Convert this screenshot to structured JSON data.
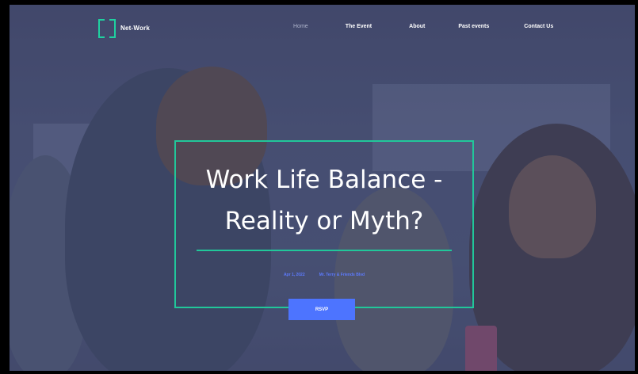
{
  "brand": {
    "name": "Net-Work",
    "accent_color": "#21c79a",
    "button_color": "#4d74ff",
    "logo_icon": "bracket-logo-icon"
  },
  "nav": {
    "links": [
      {
        "label": "Home",
        "active": true
      },
      {
        "label": "The Event",
        "active": false
      },
      {
        "label": "About",
        "active": false
      },
      {
        "label": "Past events",
        "active": false
      },
      {
        "label": "Contact Us",
        "active": false
      }
    ]
  },
  "hero": {
    "headline_line1": "Work Life Balance -",
    "headline_line2": "Reality or Myth?",
    "date": "Apr 1, 2022",
    "venue": "Mr. Terry & Friends Blvd",
    "cta_label": "RSVP"
  }
}
